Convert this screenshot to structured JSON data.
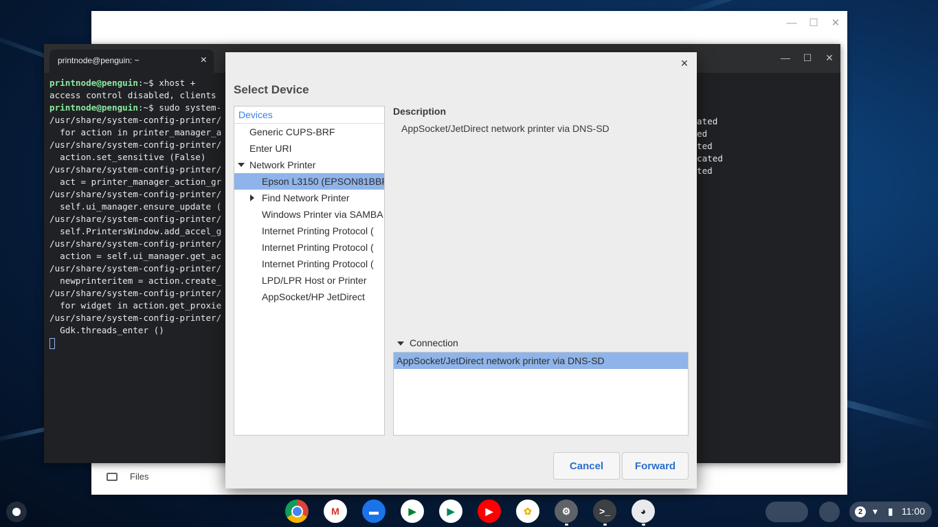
{
  "files_window": {
    "footer_label": "Files"
  },
  "terminal": {
    "tab_title": "printnode@penguin: ~",
    "prompt_user": "printnode@penguin",
    "prompt_suffix": ":~$",
    "lines": [
      {
        "type": "prompt",
        "cmd": " xhost +"
      },
      {
        "type": "text",
        "text": "access control disabled, clients"
      },
      {
        "type": "prompt",
        "cmd": " sudo system-"
      },
      {
        "type": "text",
        "text": "/usr/share/system-config-printer/"
      },
      {
        "type": "text",
        "text": "  for action in printer_manager_a"
      },
      {
        "type": "text",
        "text": "/usr/share/system-config-printer/"
      },
      {
        "type": "text",
        "text": "  action.set_sensitive (False)"
      },
      {
        "type": "text",
        "text": "/usr/share/system-config-printer/"
      },
      {
        "type": "text",
        "text": "  act = printer_manager_action_gr"
      },
      {
        "type": "text",
        "text": "/usr/share/system-config-printer/"
      },
      {
        "type": "text",
        "text": "  self.ui_manager.ensure_update ("
      },
      {
        "type": "text",
        "text": "/usr/share/system-config-printer/"
      },
      {
        "type": "text",
        "text": "  self.PrintersWindow.add_accel_g"
      },
      {
        "type": "text",
        "text": "/usr/share/system-config-printer/"
      },
      {
        "type": "text",
        "text": "  action = self.ui_manager.get_ac"
      },
      {
        "type": "text",
        "text": "/usr/share/system-config-printer/"
      },
      {
        "type": "text",
        "text": "  newprinteritem = action.create_"
      },
      {
        "type": "text",
        "text": "/usr/share/system-config-printer/"
      },
      {
        "type": "text",
        "text": "  for widget in action.get_proxie"
      },
      {
        "type": "text",
        "text": "/usr/share/system-config-printer/"
      },
      {
        "type": "text",
        "text": "  Gdk.threads_enter ()"
      }
    ],
    "right_fragments": [
      "ated",
      "",
      "ed",
      "",
      "ted",
      "",
      "cated",
      "",
      "",
      "ted"
    ]
  },
  "dialog": {
    "title": "Select Device",
    "close_glyph": "×",
    "devices_header": "Devices",
    "devices": [
      {
        "label": "Generic CUPS-BRF",
        "level": 0,
        "expander": "none",
        "selected": false
      },
      {
        "label": "Enter URI",
        "level": 0,
        "expander": "none",
        "selected": false
      },
      {
        "label": "Network Printer",
        "level": 0,
        "expander": "expanded",
        "selected": false
      },
      {
        "label": "Epson L3150 (EPSON81BBF",
        "level": 1,
        "expander": "none",
        "selected": true
      },
      {
        "label": "Find Network Printer",
        "level": 1,
        "expander": "collapsed",
        "selected": false
      },
      {
        "label": "Windows Printer via SAMBA",
        "level": 1,
        "expander": "none",
        "selected": false
      },
      {
        "label": "Internet Printing Protocol (",
        "level": 1,
        "expander": "none",
        "selected": false
      },
      {
        "label": "Internet Printing Protocol (",
        "level": 1,
        "expander": "none",
        "selected": false
      },
      {
        "label": "Internet Printing Protocol (",
        "level": 1,
        "expander": "none",
        "selected": false
      },
      {
        "label": "LPD/LPR Host or Printer",
        "level": 1,
        "expander": "none",
        "selected": false
      },
      {
        "label": "AppSocket/HP JetDirect",
        "level": 1,
        "expander": "none",
        "selected": false
      }
    ],
    "description_heading": "Description",
    "description_text": "AppSocket/JetDirect network printer via DNS-SD",
    "connection_heading": "Connection",
    "connection_selected": "AppSocket/JetDirect network printer via DNS-SD",
    "cancel_label": "Cancel",
    "forward_label": "Forward"
  },
  "shelf": {
    "apps": [
      {
        "name": "chrome-icon",
        "color": "#db4437",
        "running": false
      },
      {
        "name": "gmail-icon",
        "color": "#ffffff",
        "running": false
      },
      {
        "name": "files-app-icon",
        "color": "#1a73e8",
        "running": false
      },
      {
        "name": "google-meet-icon",
        "color": "#ffffff",
        "running": false
      },
      {
        "name": "play-store-icon",
        "color": "#ffffff",
        "running": false
      },
      {
        "name": "youtube-icon",
        "color": "#ff0000",
        "running": false
      },
      {
        "name": "google-photos-icon",
        "color": "#ffffff",
        "running": false
      },
      {
        "name": "settings-icon",
        "color": "#5f6368",
        "running": true
      },
      {
        "name": "terminal-icon",
        "color": "#3c4043",
        "running": true
      },
      {
        "name": "penguin-icon",
        "color": "#e8eaed",
        "running": true
      }
    ],
    "notification_count": "2",
    "time": "11:00"
  },
  "colors": {
    "selection": "#8fb4ea",
    "accent": "#3584e4",
    "button_text": "#2a6fcf"
  }
}
